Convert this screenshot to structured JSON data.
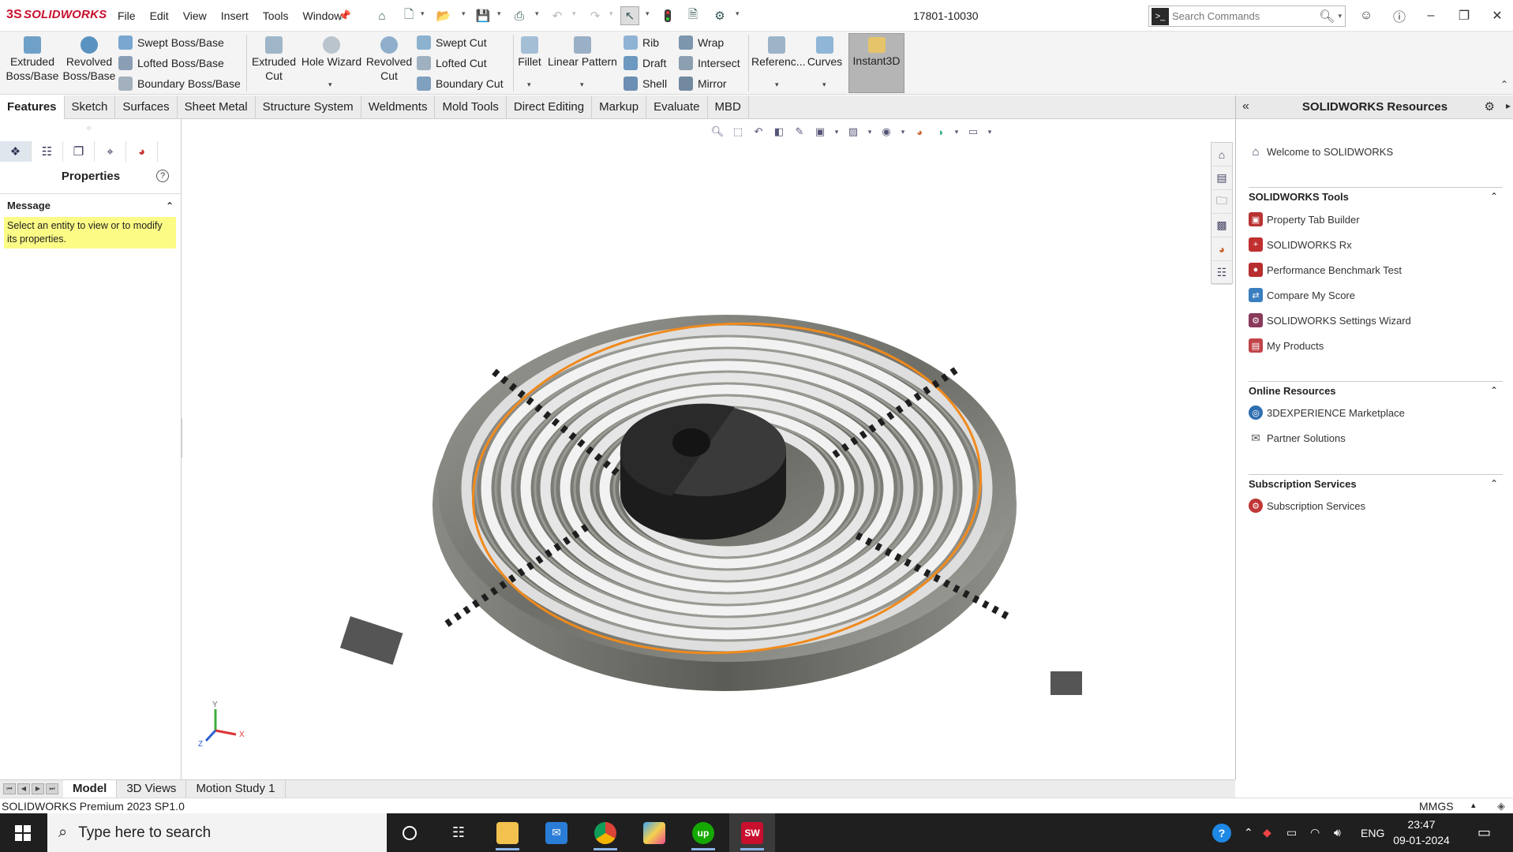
{
  "app": {
    "logo_prefix": "3S",
    "logo_text": "SOLIDWORKS",
    "document_name": "17801-10030",
    "menus": [
      "File",
      "Edit",
      "View",
      "Insert",
      "Tools",
      "Window"
    ],
    "search_placeholder": "Search Commands"
  },
  "ribbon": {
    "extruded_boss": "Extruded Boss/Base",
    "revolved_boss": "Revolved Boss/Base",
    "swept_boss": "Swept Boss/Base",
    "lofted_boss": "Lofted Boss/Base",
    "boundary_boss": "Boundary Boss/Base",
    "extruded_cut": "Extruded Cut",
    "hole_wizard": "Hole Wizard",
    "revolved_cut": "Revolved Cut",
    "swept_cut": "Swept Cut",
    "lofted_cut": "Lofted Cut",
    "boundary_cut": "Boundary Cut",
    "fillet": "Fillet",
    "linear_pattern": "Linear Pattern",
    "rib": "Rib",
    "draft": "Draft",
    "shell": "Shell",
    "wrap": "Wrap",
    "intersect": "Intersect",
    "mirror": "Mirror",
    "reference": "Referenc...",
    "curves": "Curves",
    "instant3d": "Instant3D"
  },
  "tabs": [
    "Features",
    "Sketch",
    "Surfaces",
    "Sheet Metal",
    "Structure System",
    "Weldments",
    "Mold Tools",
    "Direct Editing",
    "Markup",
    "Evaluate",
    "MBD"
  ],
  "properties": {
    "title": "Properties",
    "message_header": "Message",
    "message_text": "Select an entity to view or to modify its properties."
  },
  "triad": {
    "y": "Y",
    "x": "X",
    "z": "Z"
  },
  "resources": {
    "title": "SOLIDWORKS Resources",
    "welcome": "Welcome to SOLIDWORKS",
    "tools_header": "SOLIDWORKS Tools",
    "tools": [
      "Property Tab Builder",
      "SOLIDWORKS Rx",
      "Performance Benchmark Test",
      "Compare My Score",
      "SOLIDWORKS Settings Wizard",
      "My Products"
    ],
    "online_header": "Online Resources",
    "online": [
      "3DEXPERIENCE Marketplace",
      "Partner Solutions"
    ],
    "subscription_header": "Subscription Services",
    "subscription": [
      "Subscription Services"
    ]
  },
  "bottom_tabs": [
    "Model",
    "3D Views",
    "Motion Study 1"
  ],
  "status": {
    "text": "SOLIDWORKS Premium 2023 SP1.0",
    "units": "MMGS"
  },
  "taskbar": {
    "search_placeholder": "Type here to search",
    "language": "ENG",
    "time": "23:47",
    "date": "09-01-2024",
    "apps": [
      "task-view",
      "file-explorer",
      "mail",
      "chrome",
      "paint",
      "upwork",
      "solidworks"
    ]
  },
  "colors": {
    "brand_red": "#c8102e",
    "highlight_orange": "#f08a1c",
    "message_yellow": "#fbfb86",
    "taskbar": "#1f1f1f"
  }
}
